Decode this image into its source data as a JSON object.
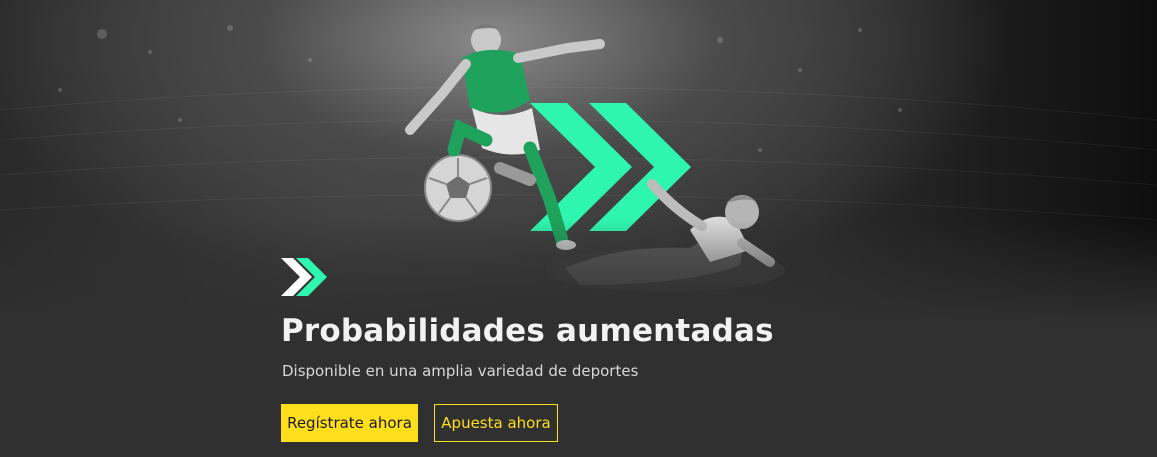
{
  "colors": {
    "accent": "#2ef5b0",
    "cta_yellow": "#ffdf1b",
    "background": "#303030",
    "jersey_green": "#1fa35c"
  },
  "hero": {
    "illustration": "soccer-players-with-green-chevrons",
    "chevron_icon": "double-chevron-right-icon",
    "title": "Probabilidades aumentadas",
    "subtitle": "Disponible en una amplia variedad de deportes"
  },
  "actions": {
    "register_label": "Regístrate ahora",
    "bet_label": "Apuesta ahora"
  }
}
